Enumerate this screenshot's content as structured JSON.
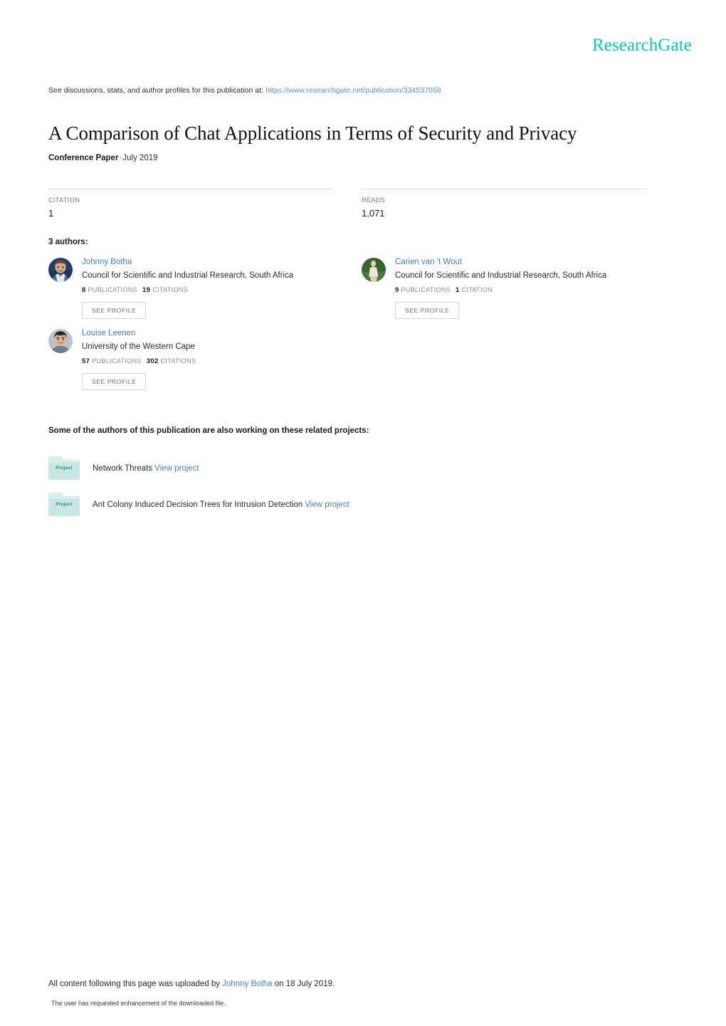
{
  "brand": {
    "name": "ResearchGate",
    "color": "#00ccbb"
  },
  "discussions": {
    "prefix": "See discussions, stats, and author profiles for this publication at:",
    "url": "https://www.researchgate.net/publication/334537058",
    "link_color": "#5b8fc9"
  },
  "title": "A Comparison of Chat Applications in Terms of Security and Privacy",
  "publication": {
    "type": "Conference Paper",
    "separator": "·",
    "date": "July 2019"
  },
  "stats": [
    {
      "label": "CITATION",
      "value": "1"
    },
    {
      "label": "READS",
      "value": "1,071"
    }
  ],
  "authors_heading": "3 authors:",
  "authors": [
    {
      "name": "Johnny Botha",
      "affiliation": "Council for Scientific and Industrial Research, South Africa",
      "publications_count": "8",
      "publications_label": "PUBLICATIONS",
      "citations_count": "19",
      "citations_label": "CITATIONS",
      "button_label": "SEE PROFILE",
      "avatar": "avatar-johnny-botha"
    },
    {
      "name": "Carien van 't Wout",
      "affiliation": "Council for Scientific and Industrial Research, South Africa",
      "publications_count": "9",
      "publications_label": "PUBLICATIONS",
      "citations_count": "1",
      "citations_label": "CITATION",
      "button_label": "SEE PROFILE",
      "avatar": "avatar-carien-van-t-wout"
    },
    {
      "name": "Louise Leenen",
      "affiliation": "University of the Western Cape",
      "publications_count": "57",
      "publications_label": "PUBLICATIONS",
      "citations_count": "302",
      "citations_label": "CITATIONS",
      "button_label": "SEE PROFILE",
      "avatar": "avatar-louise-leenen"
    }
  ],
  "projects_heading": "Some of the authors of this publication are also working on these related projects:",
  "projects": [
    {
      "icon_label": "Project",
      "title": "Network Threats",
      "link_label": "View project"
    },
    {
      "icon_label": "Project",
      "title": "Ant Colony Induced Decision Trees for Intrusion Detection",
      "link_label": "View project"
    }
  ],
  "footer": {
    "upload_prefix": "All content following this page was uploaded by",
    "uploader": "Johnny Botha",
    "upload_suffix": "on 18 July 2019.",
    "note": "The user has requested enhancement of the downloaded file."
  }
}
